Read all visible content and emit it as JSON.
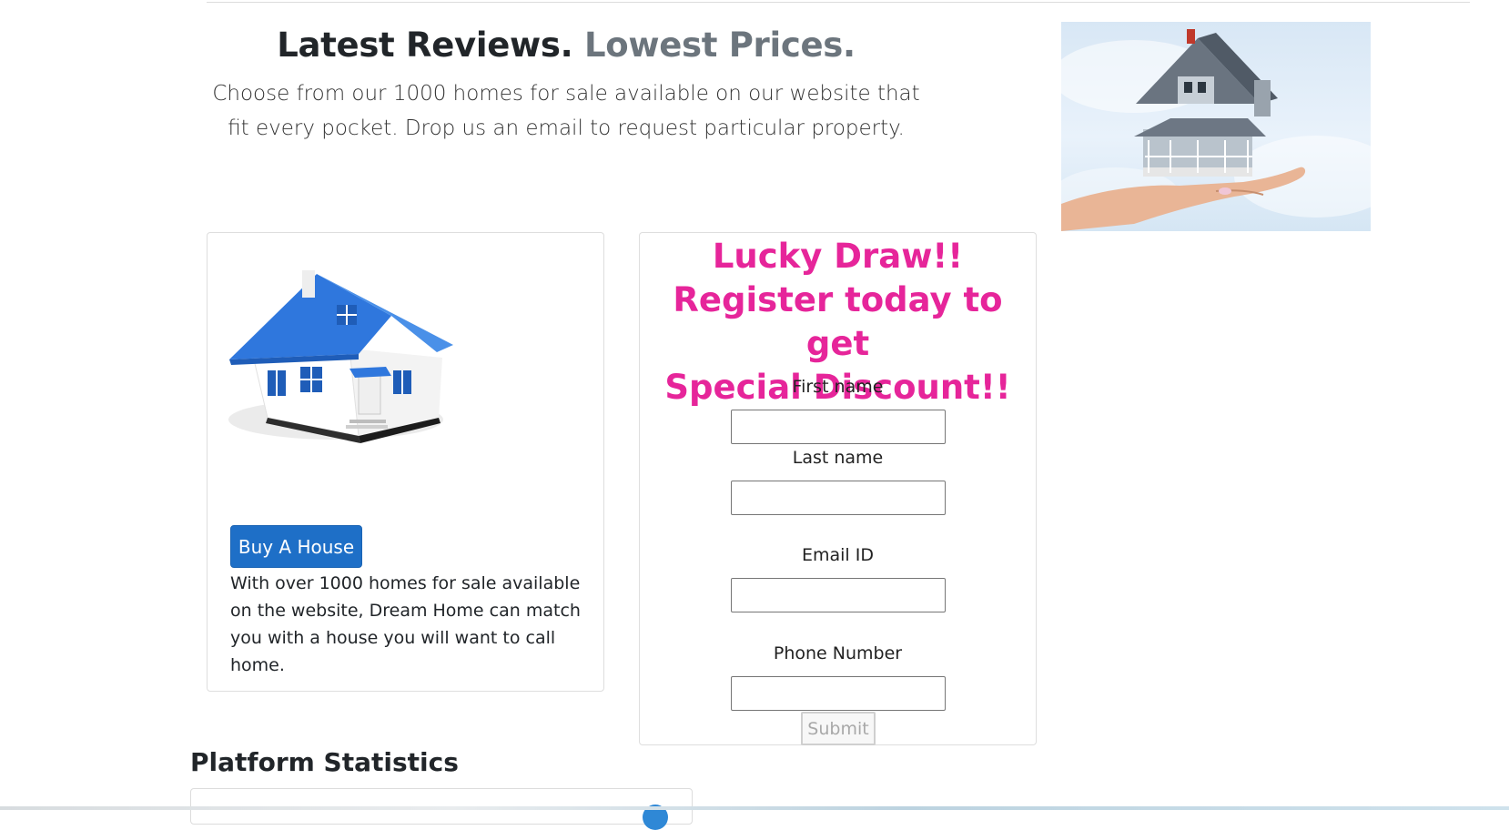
{
  "hero": {
    "title_strong": "Latest Reviews.",
    "title_muted": "Lowest Prices.",
    "lead": "Choose from our 1000 homes for sale available on our website that fit every pocket. Drop us an email to request particular property."
  },
  "buy_card": {
    "button_label": "Buy A House",
    "description": "With over 1000 homes for sale available on the website, Dream Home can match you with a house you will want to call home."
  },
  "lucky_draw": {
    "title_line1": "Lucky Draw!!",
    "title_line2": "Register today to get",
    "title_line3": "Special Discount!!",
    "fields": {
      "first_name_label": "First name",
      "first_name_value": "",
      "last_name_label": "Last name",
      "last_name_value": "",
      "email_label": "Email ID",
      "email_value": "",
      "phone_label": "Phone Number",
      "phone_value": ""
    },
    "submit_label": "Submit"
  },
  "stats": {
    "heading": "Platform Statistics"
  },
  "colors": {
    "primary_button": "#1e6fc7",
    "promo_pink": "#e6259a",
    "muted_text": "#6c757d"
  }
}
